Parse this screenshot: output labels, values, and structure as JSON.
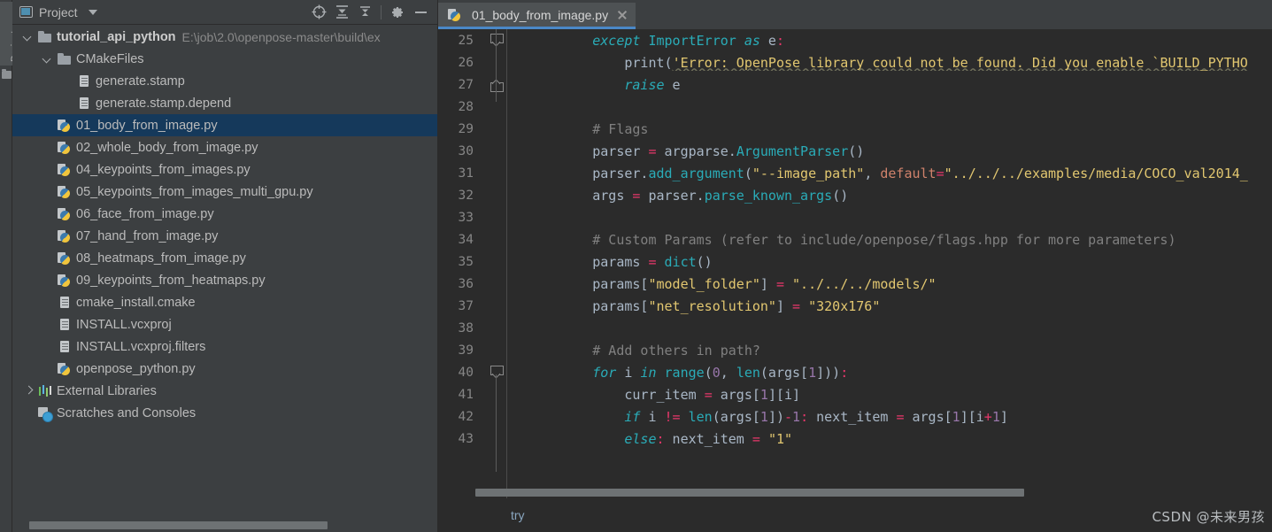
{
  "toolstrip": {
    "project_tab_label": "Project",
    "folder_icon": "folder-icon"
  },
  "project_panel": {
    "title": "Project",
    "icons": {
      "panel": "project-panel-icon",
      "dropdown": "chevron-down-icon",
      "locate": "scroll-from-source-icon",
      "expand": "expand-all-icon",
      "collapse": "collapse-all-icon",
      "settings": "gear-icon",
      "hide": "minimize-icon"
    },
    "tree": [
      {
        "indent": 0,
        "twisty": "open",
        "icon": "folder",
        "label": "tutorial_api_python",
        "bold": true,
        "path": "E:\\job\\2.0\\openpose-master\\build\\ex",
        "selected": false
      },
      {
        "indent": 1,
        "twisty": "open",
        "icon": "folder",
        "label": "CMakeFiles",
        "bold": false,
        "path": "",
        "selected": false
      },
      {
        "indent": 2,
        "twisty": "none",
        "icon": "file",
        "label": "generate.stamp",
        "bold": false,
        "path": "",
        "selected": false
      },
      {
        "indent": 2,
        "twisty": "none",
        "icon": "file",
        "label": "generate.stamp.depend",
        "bold": false,
        "path": "",
        "selected": false
      },
      {
        "indent": 1,
        "twisty": "none",
        "icon": "py",
        "label": "01_body_from_image.py",
        "bold": false,
        "path": "",
        "selected": true
      },
      {
        "indent": 1,
        "twisty": "none",
        "icon": "py",
        "label": "02_whole_body_from_image.py",
        "bold": false,
        "path": "",
        "selected": false
      },
      {
        "indent": 1,
        "twisty": "none",
        "icon": "py",
        "label": "04_keypoints_from_images.py",
        "bold": false,
        "path": "",
        "selected": false
      },
      {
        "indent": 1,
        "twisty": "none",
        "icon": "py",
        "label": "05_keypoints_from_images_multi_gpu.py",
        "bold": false,
        "path": "",
        "selected": false
      },
      {
        "indent": 1,
        "twisty": "none",
        "icon": "py",
        "label": "06_face_from_image.py",
        "bold": false,
        "path": "",
        "selected": false
      },
      {
        "indent": 1,
        "twisty": "none",
        "icon": "py",
        "label": "07_hand_from_image.py",
        "bold": false,
        "path": "",
        "selected": false
      },
      {
        "indent": 1,
        "twisty": "none",
        "icon": "py",
        "label": "08_heatmaps_from_image.py",
        "bold": false,
        "path": "",
        "selected": false
      },
      {
        "indent": 1,
        "twisty": "none",
        "icon": "py",
        "label": "09_keypoints_from_heatmaps.py",
        "bold": false,
        "path": "",
        "selected": false
      },
      {
        "indent": 1,
        "twisty": "none",
        "icon": "file",
        "label": "cmake_install.cmake",
        "bold": false,
        "path": "",
        "selected": false
      },
      {
        "indent": 1,
        "twisty": "none",
        "icon": "file",
        "label": "INSTALL.vcxproj",
        "bold": false,
        "path": "",
        "selected": false
      },
      {
        "indent": 1,
        "twisty": "none",
        "icon": "file",
        "label": "INSTALL.vcxproj.filters",
        "bold": false,
        "path": "",
        "selected": false
      },
      {
        "indent": 1,
        "twisty": "none",
        "icon": "py",
        "label": "openpose_python.py",
        "bold": false,
        "path": "",
        "selected": false
      },
      {
        "indent": 0,
        "twisty": "closed",
        "icon": "libs",
        "label": "External Libraries",
        "bold": false,
        "path": "",
        "selected": false
      },
      {
        "indent": 0,
        "twisty": "none",
        "icon": "scratch",
        "label": "Scratches and Consoles",
        "bold": false,
        "path": "",
        "selected": false
      }
    ]
  },
  "editor": {
    "tab": {
      "label": "01_body_from_image.py",
      "icon": "python-file-icon",
      "close_icon": "close-icon",
      "active": true
    },
    "first_line_number": 25,
    "lines": [
      {
        "n": 25,
        "fold": "start",
        "tokens": [
          {
            "t": "        ",
            "c": "def"
          },
          {
            "t": "except",
            "c": "kwi"
          },
          {
            "t": " ",
            "c": "def"
          },
          {
            "t": "ImportError",
            "c": "cls"
          },
          {
            "t": " ",
            "c": "def"
          },
          {
            "t": "as",
            "c": "kwi"
          },
          {
            "t": " e",
            "c": "def"
          },
          {
            "t": ":",
            "c": "op"
          }
        ]
      },
      {
        "n": 26,
        "fold": "none",
        "tokens": [
          {
            "t": "            ",
            "c": "def"
          },
          {
            "t": "print",
            "c": "def"
          },
          {
            "t": "(",
            "c": "def"
          },
          {
            "t": "'Error: OpenPose library could not be found. Did you enable `BUILD_PYTHO",
            "c": "str squig"
          }
        ]
      },
      {
        "n": 27,
        "fold": "end",
        "tokens": [
          {
            "t": "            ",
            "c": "def"
          },
          {
            "t": "raise",
            "c": "kwi"
          },
          {
            "t": " e",
            "c": "def"
          }
        ]
      },
      {
        "n": 28,
        "fold": "none",
        "tokens": []
      },
      {
        "n": 29,
        "fold": "none",
        "tokens": [
          {
            "t": "        ",
            "c": "def"
          },
          {
            "t": "# Flags",
            "c": "cmt"
          }
        ]
      },
      {
        "n": 30,
        "fold": "none",
        "tokens": [
          {
            "t": "        parser ",
            "c": "def"
          },
          {
            "t": "=",
            "c": "op"
          },
          {
            "t": " argparse.",
            "c": "def"
          },
          {
            "t": "ArgumentParser",
            "c": "cls"
          },
          {
            "t": "()",
            "c": "def"
          }
        ]
      },
      {
        "n": 31,
        "fold": "none",
        "tokens": [
          {
            "t": "        parser.",
            "c": "def"
          },
          {
            "t": "add_argument",
            "c": "cls"
          },
          {
            "t": "(",
            "c": "def"
          },
          {
            "t": "\"--image_path\"",
            "c": "str"
          },
          {
            "t": ", ",
            "c": "def"
          },
          {
            "t": "default",
            "c": "kwr"
          },
          {
            "t": "=",
            "c": "op"
          },
          {
            "t": "\"../../../examples/media/COCO_val2014_",
            "c": "str"
          }
        ]
      },
      {
        "n": 32,
        "fold": "none",
        "tokens": [
          {
            "t": "        args ",
            "c": "def"
          },
          {
            "t": "=",
            "c": "op"
          },
          {
            "t": " parser.",
            "c": "def"
          },
          {
            "t": "parse_known_args",
            "c": "cls"
          },
          {
            "t": "()",
            "c": "def"
          }
        ]
      },
      {
        "n": 33,
        "fold": "none",
        "tokens": []
      },
      {
        "n": 34,
        "fold": "none",
        "tokens": [
          {
            "t": "        ",
            "c": "def"
          },
          {
            "t": "# Custom Params (refer to include/openpose/flags.hpp for more parameters)",
            "c": "cmt"
          }
        ]
      },
      {
        "n": 35,
        "fold": "none",
        "tokens": [
          {
            "t": "        params ",
            "c": "def"
          },
          {
            "t": "=",
            "c": "op"
          },
          {
            "t": " ",
            "c": "def"
          },
          {
            "t": "dict",
            "c": "cls"
          },
          {
            "t": "()",
            "c": "def"
          }
        ]
      },
      {
        "n": 36,
        "fold": "none",
        "tokens": [
          {
            "t": "        params[",
            "c": "def"
          },
          {
            "t": "\"model_folder\"",
            "c": "str"
          },
          {
            "t": "] ",
            "c": "def"
          },
          {
            "t": "=",
            "c": "op"
          },
          {
            "t": " ",
            "c": "def"
          },
          {
            "t": "\"../../../models/\"",
            "c": "str"
          }
        ]
      },
      {
        "n": 37,
        "fold": "none",
        "tokens": [
          {
            "t": "        params[",
            "c": "def"
          },
          {
            "t": "\"net_resolution\"",
            "c": "str"
          },
          {
            "t": "] ",
            "c": "def"
          },
          {
            "t": "=",
            "c": "op"
          },
          {
            "t": " ",
            "c": "def"
          },
          {
            "t": "\"320x176\"",
            "c": "str"
          }
        ]
      },
      {
        "n": 38,
        "fold": "none",
        "tokens": []
      },
      {
        "n": 39,
        "fold": "none",
        "tokens": [
          {
            "t": "        ",
            "c": "def"
          },
          {
            "t": "# Add others in path?",
            "c": "cmt"
          }
        ]
      },
      {
        "n": 40,
        "fold": "start",
        "tokens": [
          {
            "t": "        ",
            "c": "def"
          },
          {
            "t": "for",
            "c": "kwi"
          },
          {
            "t": " i ",
            "c": "def"
          },
          {
            "t": "in",
            "c": "kwi"
          },
          {
            "t": " ",
            "c": "def"
          },
          {
            "t": "range",
            "c": "cls"
          },
          {
            "t": "(",
            "c": "def"
          },
          {
            "t": "0",
            "c": "num"
          },
          {
            "t": ", ",
            "c": "def"
          },
          {
            "t": "len",
            "c": "cls"
          },
          {
            "t": "(args[",
            "c": "def"
          },
          {
            "t": "1",
            "c": "num"
          },
          {
            "t": "]))",
            "c": "def"
          },
          {
            "t": ":",
            "c": "op"
          }
        ]
      },
      {
        "n": 41,
        "fold": "none",
        "tokens": [
          {
            "t": "            curr_item ",
            "c": "def"
          },
          {
            "t": "=",
            "c": "op"
          },
          {
            "t": " args[",
            "c": "def"
          },
          {
            "t": "1",
            "c": "num"
          },
          {
            "t": "][i]",
            "c": "def"
          }
        ]
      },
      {
        "n": 42,
        "fold": "none",
        "tokens": [
          {
            "t": "            ",
            "c": "def"
          },
          {
            "t": "if",
            "c": "kwi"
          },
          {
            "t": " i ",
            "c": "def"
          },
          {
            "t": "!=",
            "c": "op"
          },
          {
            "t": " ",
            "c": "def"
          },
          {
            "t": "len",
            "c": "cls"
          },
          {
            "t": "(args[",
            "c": "def"
          },
          {
            "t": "1",
            "c": "num"
          },
          {
            "t": "])",
            "c": "def"
          },
          {
            "t": "-",
            "c": "op"
          },
          {
            "t": "1",
            "c": "num"
          },
          {
            "t": ":",
            "c": "op"
          },
          {
            "t": " next_item ",
            "c": "def"
          },
          {
            "t": "=",
            "c": "op"
          },
          {
            "t": " args[",
            "c": "def"
          },
          {
            "t": "1",
            "c": "num"
          },
          {
            "t": "][i",
            "c": "def"
          },
          {
            "t": "+",
            "c": "op"
          },
          {
            "t": "1",
            "c": "num"
          },
          {
            "t": "]",
            "c": "def"
          }
        ]
      },
      {
        "n": 43,
        "fold": "none",
        "tokens": [
          {
            "t": "            ",
            "c": "def"
          },
          {
            "t": "else",
            "c": "kwi"
          },
          {
            "t": ":",
            "c": "op"
          },
          {
            "t": " next_item ",
            "c": "def"
          },
          {
            "t": "=",
            "c": "op"
          },
          {
            "t": " ",
            "c": "def"
          },
          {
            "t": "\"1\"",
            "c": "str"
          }
        ]
      }
    ],
    "breadcrumb": "try",
    "watermark": "CSDN @未来男孩"
  },
  "colors": {
    "panel_bg": "#3c3f41",
    "editor_bg": "#2b2b2b",
    "selection_bg": "#15395b",
    "tab_active_underline": "#4a88c7",
    "text": "#bbbbbb",
    "string": "#e2c770",
    "keyword": "#cc7832",
    "comment": "#808080",
    "number": "#9876aa",
    "operator": "#e8376b"
  }
}
